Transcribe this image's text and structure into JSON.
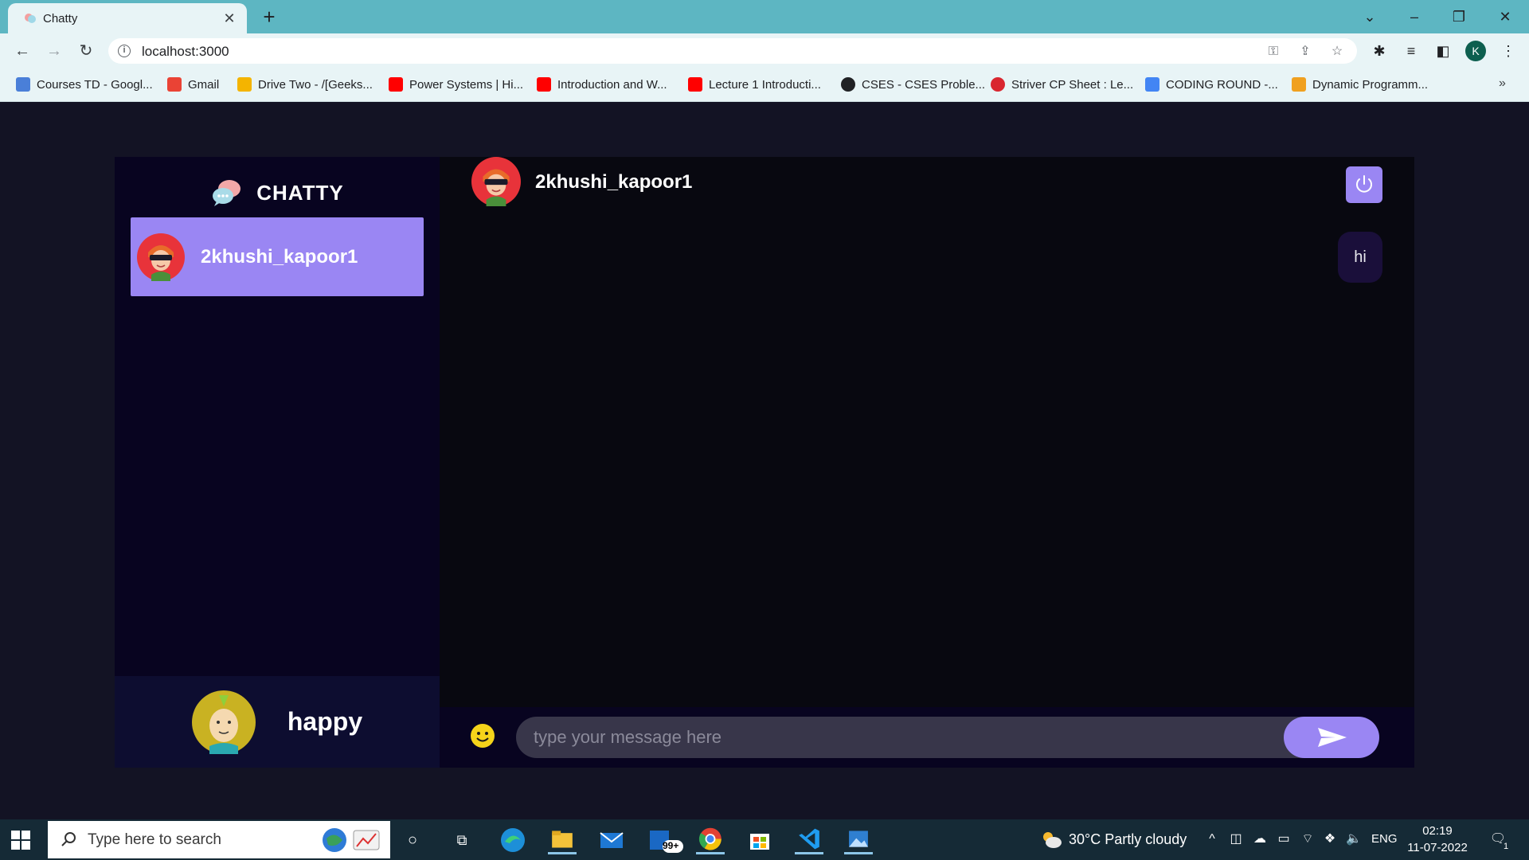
{
  "browser": {
    "tab_title": "Chatty",
    "url": "localhost:3000",
    "profile_initial": "K",
    "bookmarks": [
      "Courses TD - Googl...",
      "Gmail",
      "Drive Two - /[Geeks...",
      "Power Systems | Hi...",
      "Introduction and W...",
      "Lecture 1 Introducti...",
      "CSES - CSES Proble...",
      "Striver CP Sheet : Le...",
      "CODING ROUND -...",
      "Dynamic Programm..."
    ]
  },
  "app": {
    "brand": "CHATTY",
    "contacts": [
      {
        "username": "2khushi_kapoor1",
        "selected": true
      }
    ],
    "current_user": {
      "username": "happy"
    },
    "chat": {
      "title": "2khushi_kapoor1",
      "messages": [
        {
          "text": "hi",
          "type": "sended"
        }
      ]
    },
    "input": {
      "placeholder": "type your message here",
      "value": ""
    },
    "colors": {
      "accent": "#9a86f3",
      "background": "#131324",
      "sidebar": "#080420",
      "chat_bg": "#080810",
      "bubble": "#1a0f3a",
      "input_bg": "#38364a"
    }
  },
  "taskbar": {
    "search_placeholder": "Type here to search",
    "weather": "30°C  Partly cloudy",
    "language": "ENG",
    "time": "02:19",
    "date": "11-07-2022",
    "mail_badge": "99+",
    "notification_count": "1"
  }
}
